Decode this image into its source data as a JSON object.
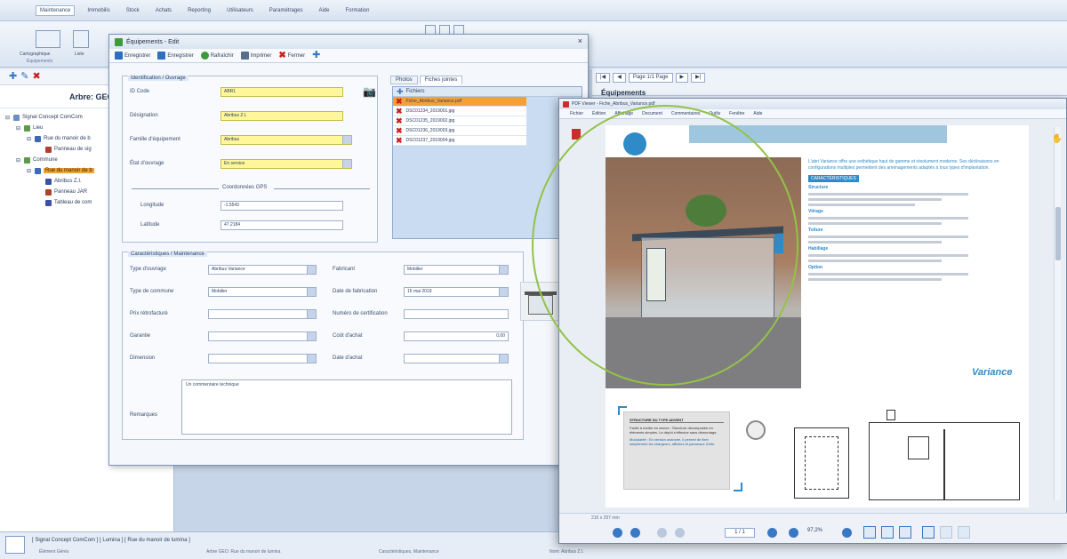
{
  "app": {
    "menu_items": [
      "Maintenance",
      "Immobilis",
      "Stock",
      "Achats",
      "Reporting",
      "Utilisateurs",
      "Paramétrages",
      "Aide",
      "Formation"
    ],
    "ribbon": {
      "btn1_label": "Cartographique",
      "btn2_label": "Liste",
      "group_label": "Équipements"
    },
    "left_panel": {
      "header": "Arbre: GEO",
      "tree": [
        {
          "label": "Signal Concept ComCom",
          "level": 0,
          "color": "#6b8fc2",
          "selected": false
        },
        {
          "label": "Lieu",
          "level": 1,
          "color": "#5a9a4a",
          "selected": false
        },
        {
          "label": "Rue du manoir de b",
          "level": 2,
          "color": "#3d6ab0",
          "selected": false
        },
        {
          "label": "Panneau de sig",
          "level": 3,
          "color": "#b0402e",
          "selected": false
        },
        {
          "label": "Commune",
          "level": 1,
          "color": "#5a9a4a",
          "selected": false
        },
        {
          "label": "Rue du manoir de b",
          "level": 2,
          "color": "#3d6ab0",
          "selected": true
        },
        {
          "label": "Abribus Z.I.",
          "level": 3,
          "color": "#3d4fa8",
          "selected": false
        },
        {
          "label": "Panneau JAR",
          "level": 3,
          "color": "#b0402e",
          "selected": false
        },
        {
          "label": "Tableau de com",
          "level": 3,
          "color": "#3d4fa8",
          "selected": false
        }
      ]
    },
    "doc_panel": {
      "pager_label": "Page 1/1 Page",
      "title": "Équipements"
    },
    "status": {
      "path": "[ Signal Concept ComCom ] [ Lumina ] [ Rue du manoir de lumina ]",
      "info_left": "Élément Gérés",
      "info_mid": "Arbre GEO: Rue du manoir de lumina",
      "info_right": "Caractéristiques, Maintenance",
      "info_far": "Nom: Abribus Z.I."
    }
  },
  "dialog": {
    "title": "Équipements - Edit",
    "close": "×",
    "toolbar": [
      "Enregistrer",
      "Enregistrer",
      "Rafraîchir",
      "Imprimer",
      "Fermer"
    ],
    "identity_group": {
      "title": "Identification / Ouvrage",
      "fields": [
        {
          "label": "ID Code",
          "value": "ABR1",
          "yellow": true,
          "dropdown": false
        },
        {
          "label": "Désignation",
          "value": "Abribus Z.I.",
          "yellow": true,
          "dropdown": false
        },
        {
          "label": "Famille d'équipement",
          "value": "Abribus",
          "yellow": true,
          "dropdown": true
        },
        {
          "label": "État d'ouvrage",
          "value": "En service",
          "yellow": true,
          "dropdown": true
        }
      ],
      "coord_label": "Coordonnées GPS",
      "coords": [
        {
          "label": "Longitude",
          "value": "-1.5543"
        },
        {
          "label": "Latitude",
          "value": "47.2184"
        }
      ]
    },
    "tabs": [
      "Photos",
      "Fiches jointes"
    ],
    "photo_list": {
      "header": "Fichiers",
      "rows": [
        {
          "name": "Fiche_Abribus_Variance.pdf",
          "selected": true
        },
        {
          "name": "DSC01234_2019001.jpg",
          "selected": false
        },
        {
          "name": "DSC01235_2019002.jpg",
          "selected": false
        },
        {
          "name": "DSC01236_2019003.jpg",
          "selected": false
        },
        {
          "name": "DSC01237_2019004.jpg",
          "selected": false
        }
      ]
    },
    "char_group": {
      "title": "Caractéristiques / Maintenance",
      "left": [
        {
          "label": "Type d'ouvrage",
          "value": "Abribus Variance",
          "dropdown": true
        },
        {
          "label": "Type de commune",
          "value": "Mobilier",
          "dropdown": true
        },
        {
          "label": "Prix rétrofacturé",
          "value": "",
          "dropdown": true
        },
        {
          "label": "Garantie",
          "value": "",
          "dropdown": true
        },
        {
          "label": "Dimension",
          "value": "",
          "dropdown": true
        }
      ],
      "right": [
        {
          "label": "Fabricant",
          "value": "Mobilier",
          "dropdown": true
        },
        {
          "label": "Date de fabrication",
          "value": "15 mai 2019",
          "dropdown": true
        },
        {
          "label": "Numéro de certification",
          "value": "",
          "dropdown": false
        },
        {
          "label": "Coût d'achat",
          "value": "0,00",
          "dropdown": false
        },
        {
          "label": "Date d'achat",
          "value": "",
          "dropdown": true
        }
      ],
      "remarks_label": "Remarques",
      "remarks_value": "Un commentaire technique"
    }
  },
  "pdf_viewer": {
    "title": "PDF Viewer - Fiche_Abribus_Variance.pdf",
    "menu": [
      "Fichier",
      "Édition",
      "Affichage",
      "Document",
      "Commentaires",
      "Outils",
      "Fenêtre",
      "Aide"
    ],
    "page": {
      "lead": "L'abri Variance offre une esthétique haut de gamme et résolument moderne. Ses déclinaisons en configurations multiples permettent des aménagements adaptés à tous types d'implantation.",
      "heading": "CARACTÉRISTIQUES",
      "sections": [
        "Structure",
        "Vitrage",
        "Toiture",
        "Habillage",
        "Option"
      ],
      "brand": "Variance",
      "card_title": "STRUCTURE DU TYPE ADVENT",
      "card_text_1": "Facile à mettre en œuvre : Structure décomposée en éléments simples. Le dépôt s'effectue sans démontage.",
      "card_text_2": "Modularité : En version avancée, il permet de fixer simplement les chargeurs, affiches et panneaux d'info."
    },
    "bottom": {
      "page_info": "1 / 1",
      "zoom": "97,2%",
      "dimensions": "210 x 297 mm"
    }
  }
}
